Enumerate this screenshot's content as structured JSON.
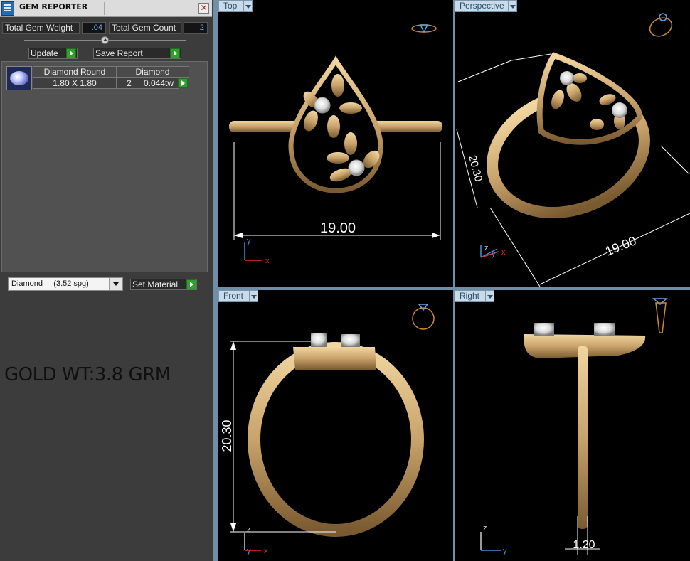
{
  "window": {
    "title": "GEM REPORTER",
    "close_symbol": "✕"
  },
  "stats": {
    "total_gem_weight_label": "Total Gem Weight",
    "total_gem_weight_value": ".04",
    "total_gem_count_label": "Total Gem Count",
    "total_gem_count_value": "2"
  },
  "actions": {
    "update_label": "Update",
    "save_report_label": "Save Report",
    "set_material_label": "Set Material"
  },
  "gem_table": {
    "headers": [
      "Diamond Round",
      "Diamond"
    ],
    "rows": [
      {
        "size": "1.80 X 1.80",
        "count": "2",
        "weight": "0.044tw"
      }
    ]
  },
  "material": {
    "selected": "Diamond     (3.52 spg)"
  },
  "note": "GOLD WT:3.8 GRM",
  "viewports": {
    "top": {
      "label": "Top",
      "dimension": "19.00",
      "axes": [
        "y",
        "x"
      ]
    },
    "perspective": {
      "label": "Perspective",
      "dimension_height": "20.30",
      "dimension_width": "19.00",
      "axes": [
        "z",
        "y",
        "x"
      ]
    },
    "front": {
      "label": "Front",
      "dimension": "20.30",
      "axes": [
        "z",
        "y",
        "x"
      ]
    },
    "right": {
      "label": "Right",
      "dimension": "1.20",
      "axes": [
        "z",
        "y"
      ]
    }
  },
  "colors": {
    "metal": "#c9a36b",
    "metal_dark": "#7a5a30",
    "viewport_bg": "#000000",
    "tab_bg": "#c9dbe8",
    "go_button": "#2ea02e",
    "axis_x": "#e03030",
    "axis_y": "#4a90e0"
  }
}
